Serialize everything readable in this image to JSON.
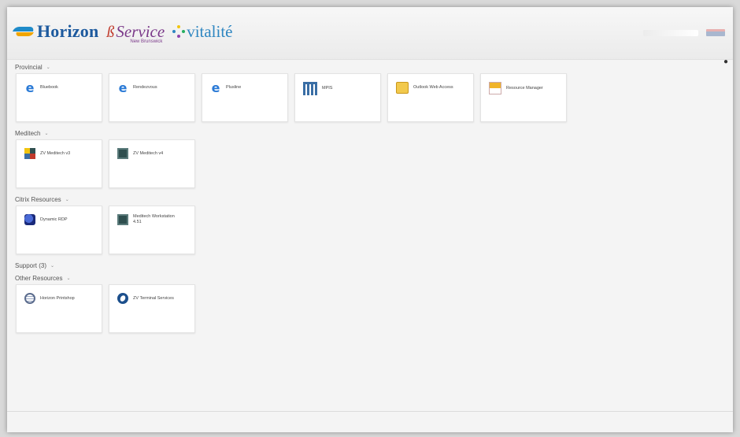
{
  "header": {
    "logo_horizon": "Horizon",
    "logo_service": "Service",
    "logo_service_sub": "New Brunswick",
    "logo_vitalite": "vitalité",
    "language": "English"
  },
  "sections": [
    {
      "title": "Provincial",
      "tiles": [
        {
          "name": "Bluebook",
          "sub": "",
          "icon": "ie-icon"
        },
        {
          "name": "Rendezvous",
          "sub": "",
          "icon": "ie-icon"
        },
        {
          "name": "Plusline",
          "sub": "",
          "icon": "ie-icon"
        },
        {
          "name": "MPIS",
          "sub": "",
          "icon": "grid-app-icon"
        },
        {
          "name": "Outlook Web Access",
          "sub": "",
          "icon": "folder-icon"
        },
        {
          "name": "Resource Manager",
          "sub": "",
          "icon": "chart-icon"
        }
      ]
    },
    {
      "title": "Meditech",
      "tiles": [
        {
          "name": "ZV Meditech v3",
          "sub": "",
          "icon": "meditech-v3-icon"
        },
        {
          "name": "ZV Meditech v4",
          "sub": "",
          "icon": "meditech-v4-icon"
        }
      ]
    },
    {
      "title": "Citrix Resources",
      "tiles": [
        {
          "name": "Dynamic RDP",
          "sub": "",
          "icon": "remote-desktop-icon"
        },
        {
          "name": "Meditech Workstation 4.51",
          "sub": "",
          "icon": "meditech-workstation-icon"
        }
      ]
    },
    {
      "title": "Support (3)",
      "tiles": []
    },
    {
      "title": "Other Resources",
      "tiles": [
        {
          "name": "Horizon Printshop",
          "sub": "",
          "icon": "globe-icon"
        },
        {
          "name": "ZV Terminal Services",
          "sub": "",
          "icon": "terminal-services-icon"
        }
      ]
    }
  ],
  "footer": {
    "text": ""
  }
}
